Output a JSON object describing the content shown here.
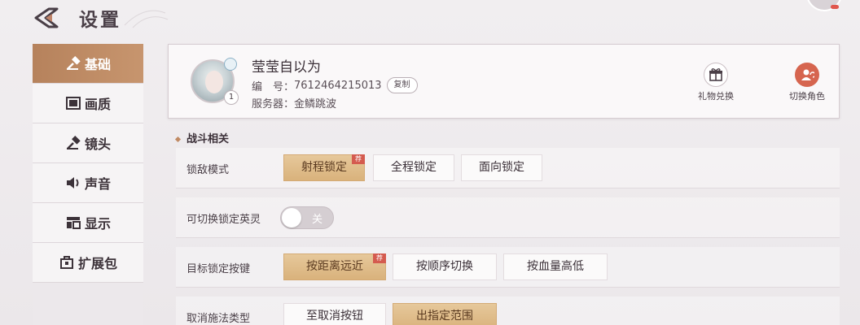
{
  "header": {
    "title": "设置"
  },
  "sidebar": {
    "items": [
      {
        "label": "基础",
        "icon": "hammer-icon",
        "active": true
      },
      {
        "label": "画质",
        "icon": "picture-icon",
        "active": false
      },
      {
        "label": "镜头",
        "icon": "camera-icon",
        "active": false
      },
      {
        "label": "声音",
        "icon": "speaker-icon",
        "active": false
      },
      {
        "label": "显示",
        "icon": "layout-icon",
        "active": false
      },
      {
        "label": "扩展包",
        "icon": "package-icon",
        "active": false
      }
    ]
  },
  "profile": {
    "nickname": "莹莹自以为",
    "id_label": "编　号：",
    "id_value": "7612464215013",
    "copy_label": "复制",
    "server_label": "服务器：",
    "server_value": "金鳞跳波",
    "level": "1",
    "gift_label": "礼物兑换",
    "switch_label": "切换角色"
  },
  "section": {
    "title": "战斗相关"
  },
  "settings": {
    "lock_mode": {
      "label": "锁敌模式",
      "options": [
        "射程锁定",
        "全程锁定",
        "面向锁定"
      ],
      "selected": "射程锁定",
      "recommend": "荐"
    },
    "switch_lock": {
      "label": "可切换锁定英灵",
      "toggle_label": "关",
      "on": false
    },
    "target_key": {
      "label": "目标锁定按键",
      "options": [
        "按距离远近",
        "按顺序切换",
        "按血量高低"
      ],
      "selected": "按距离远近",
      "recommend": "荐"
    },
    "cancel_cast": {
      "label": "取消施法类型",
      "options": [
        "至取消按钮",
        "出指定范围"
      ],
      "selected": "出指定范围"
    }
  },
  "colors": {
    "accent": "#c7956e",
    "selected": "#d9b27c",
    "badge": "#d45b4f"
  }
}
